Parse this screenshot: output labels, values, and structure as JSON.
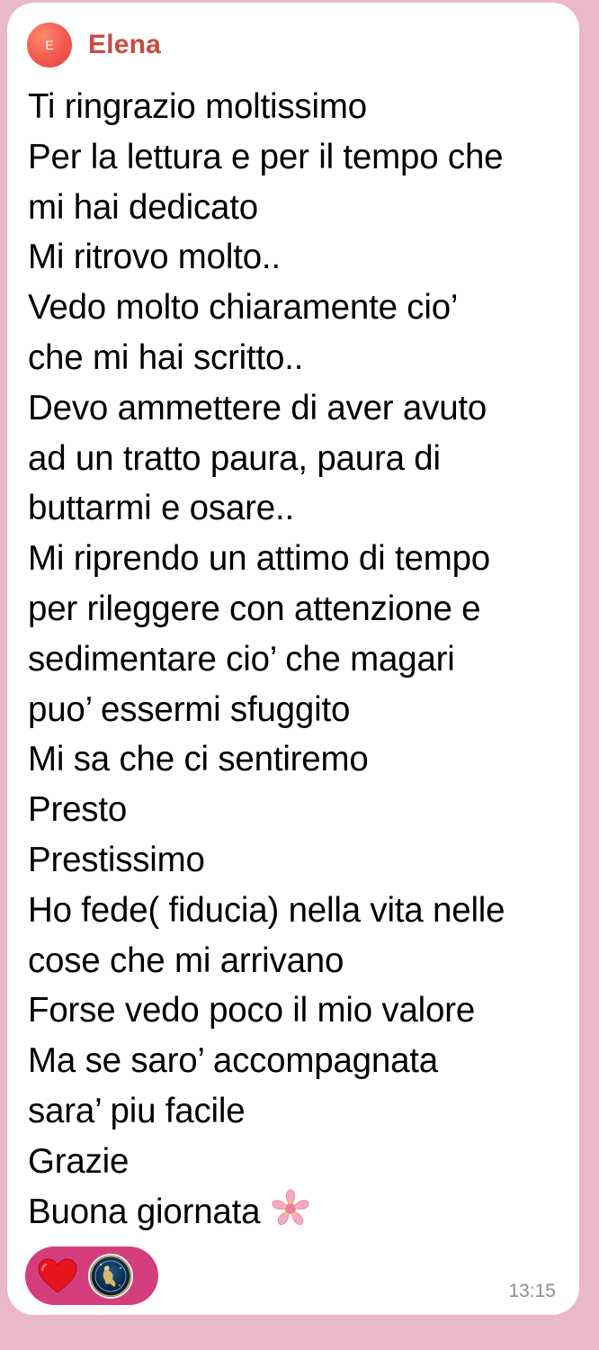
{
  "sender": {
    "avatar_initial": "E",
    "name": "Elena"
  },
  "message": {
    "lines": [
      "Ti ringrazio moltissimo",
      "Per la lettura e per il tempo che",
      "mi hai dedicato",
      "Mi ritrovo molto..",
      "Vedo molto chiaramente cio’",
      "che mi hai scritto..",
      "Devo ammettere di aver avuto",
      "ad un tratto paura, paura di",
      "buttarmi e osare..",
      "Mi riprendo un attimo di tempo",
      "per rileggere con attenzione e",
      "sedimentare cio’ che magari",
      "puo’ essermi sfuggito",
      "Mi sa che ci sentiremo",
      "Presto",
      "Prestissimo",
      "Ho fede( fiducia) nella vita nelle",
      "cose che mi arrivano",
      "Forse vedo poco il mio valore",
      "Ma se saro’ accompagnata",
      "sara’ piu facile",
      "Grazie",
      "Buona giornata"
    ],
    "trailing_emoji_icon": "cherry-blossom-icon"
  },
  "reactions": {
    "emoji_icon": "red-heart-icon",
    "reactor": "reactor-avatar"
  },
  "meta": {
    "timestamp": "13:15"
  },
  "colors": {
    "background": "#e9b9c7",
    "bubble": "#ffffff",
    "sender_name": "#cb4a3f",
    "reaction_pill": "#d43e7d",
    "timestamp": "#8e8e93"
  }
}
